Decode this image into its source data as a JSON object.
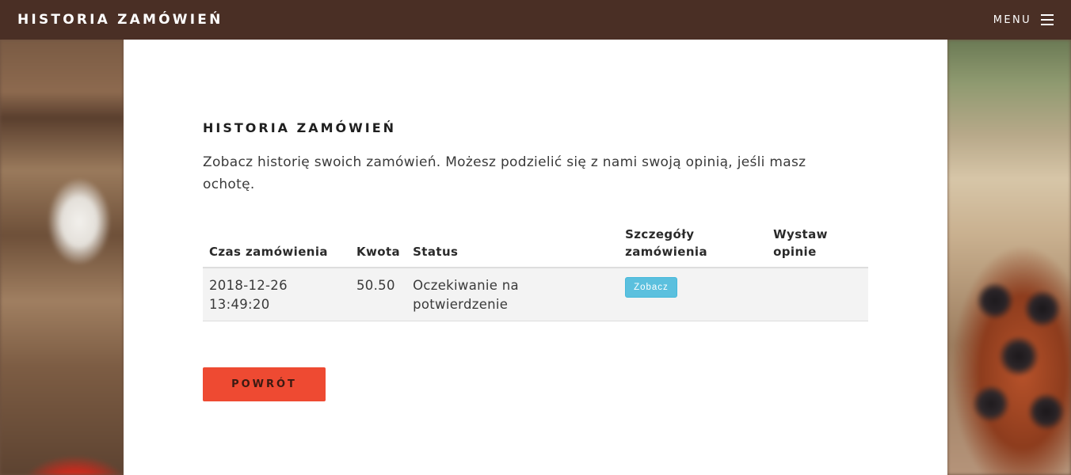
{
  "header": {
    "brand": "HISTORIA ZAMÓWIEŃ",
    "menu_label": "MENU"
  },
  "main": {
    "title": "HISTORIA ZAMÓWIEŃ",
    "intro": "Zobacz historię swoich zamówień. Możesz podzielić się z nami swoją opinią, jeśli masz ochotę.",
    "table": {
      "headers": {
        "time": "Czas zamówienia",
        "amount": "Kwota",
        "status": "Status",
        "details": "Szczegóły zamówienia",
        "review": "Wystaw opinie"
      },
      "rows": [
        {
          "time": "2018-12-26 13:49:20",
          "amount": "50.50",
          "status": "Oczekiwanie na potwierdzenie",
          "details_button": "Zobacz",
          "review": ""
        }
      ]
    },
    "back_button": "POWRÓT"
  },
  "colors": {
    "topbar": "#4a2f25",
    "view_button": "#5bc0de",
    "back_button": "#ee4a32"
  }
}
